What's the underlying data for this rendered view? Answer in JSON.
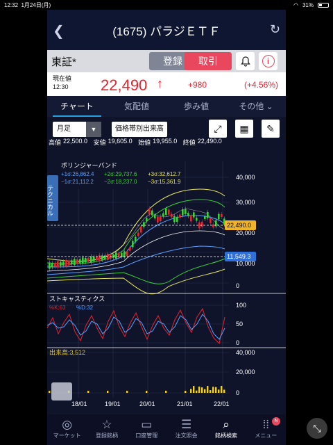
{
  "status": {
    "time": "12:32",
    "date": "1月24日(月)",
    "battery": "31%"
  },
  "header": {
    "title": "(1675) パラジＥＴＦ"
  },
  "market": {
    "name": "東証*",
    "register_label": "登録",
    "trade_label": "取引"
  },
  "quote": {
    "label1": "現在値",
    "time": "12:30",
    "price": "22,490",
    "change": "+980",
    "change_pct": "(+4.56%)"
  },
  "tabs": [
    "チャート",
    "気配値",
    "歩み値",
    "その他"
  ],
  "toolbar": {
    "period": "月足",
    "volume_btn": "価格帯別出来高"
  },
  "ohlc": {
    "high_label": "高値",
    "high": "22,500.0",
    "low_label": "安値",
    "low": "19,605.0",
    "open_label": "始値",
    "open": "19,955.0",
    "close_label": "終値",
    "close": "22,490.0"
  },
  "bb": {
    "title": "ボリンジャーバンド",
    "p1": "+1σ:26,862.4",
    "p2": "+2σ:29,737.6",
    "p3": "+3σ:32,612.7",
    "m1": "−1σ:21,112.2",
    "m2": "−2σ:18,237.0",
    "m3": "−3σ:15,361.9",
    "side_tab": "テクニカル",
    "price_tag": "22,490.0",
    "low_tag": "11,549.3",
    "y_ticks": [
      "40,000",
      "30,000",
      "20,000",
      "10,000",
      "0"
    ]
  },
  "stoch": {
    "title": "ストキャスティクス",
    "k": "%K:63",
    "d": "%D:32",
    "y_ticks": [
      "100",
      "50",
      "0"
    ]
  },
  "volume": {
    "label": "出来高:3,512",
    "y_ticks": [
      "40,000",
      "20,000",
      "0"
    ]
  },
  "x_ticks": [
    "18/01",
    "19/01",
    "20/01",
    "21/01",
    "22/01"
  ],
  "nav": [
    {
      "label": "マーケット",
      "icon": "globe-icon"
    },
    {
      "label": "登録銘柄",
      "icon": "star-icon"
    },
    {
      "label": "口座管理",
      "icon": "account-icon"
    },
    {
      "label": "注文照会",
      "icon": "orders-icon"
    },
    {
      "label": "銘柄検索",
      "icon": "search-icon"
    },
    {
      "label": "メニュー",
      "icon": "menu-icon",
      "badge": "N"
    }
  ],
  "colors": {
    "up": "#3ad13a",
    "down": "#e8232f",
    "accent": "#e8475d"
  }
}
